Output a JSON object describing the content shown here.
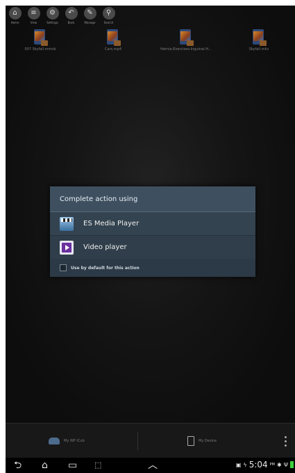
{
  "toolbar": {
    "items": [
      {
        "label": "Home",
        "icon": "home-icon",
        "glyph": "⌂"
      },
      {
        "label": "View",
        "icon": "view-icon",
        "glyph": "≡"
      },
      {
        "label": "Settings",
        "icon": "settings-icon",
        "glyph": "⚙"
      },
      {
        "label": "Back",
        "icon": "back-icon",
        "glyph": "↶"
      },
      {
        "label": "Manage",
        "icon": "manage-icon",
        "glyph": "✎"
      },
      {
        "label": "Search",
        "icon": "search-icon",
        "glyph": "⚲"
      }
    ]
  },
  "files": [
    {
      "name": "007 Skyfall.mmvb"
    },
    {
      "name": "Cars.mp4"
    },
    {
      "name": "Hernia-Exercises-Inguinal-H..."
    },
    {
      "name": "Skyfall.mkv"
    }
  ],
  "dialog": {
    "title": "Complete action using",
    "options": [
      {
        "label": "ES Media Player"
      },
      {
        "label": "Video player"
      }
    ],
    "default_label": "Use by default for this action",
    "default_checked": false
  },
  "tabbar": {
    "cloud_label": "My WP iCub",
    "device_label": "My Device"
  },
  "navbar": {
    "back_glyph": "⮌",
    "home_glyph": "⌂",
    "recents_glyph": "▭",
    "screenshot_glyph": "⬚",
    "up_glyph": "︿"
  },
  "status": {
    "time": "5:04",
    "ampm": "PM"
  },
  "colors": {
    "dialog_bg": "#2b3a46",
    "dialog_title_bg": "#3e5060",
    "battery": "#3fcf3f"
  }
}
